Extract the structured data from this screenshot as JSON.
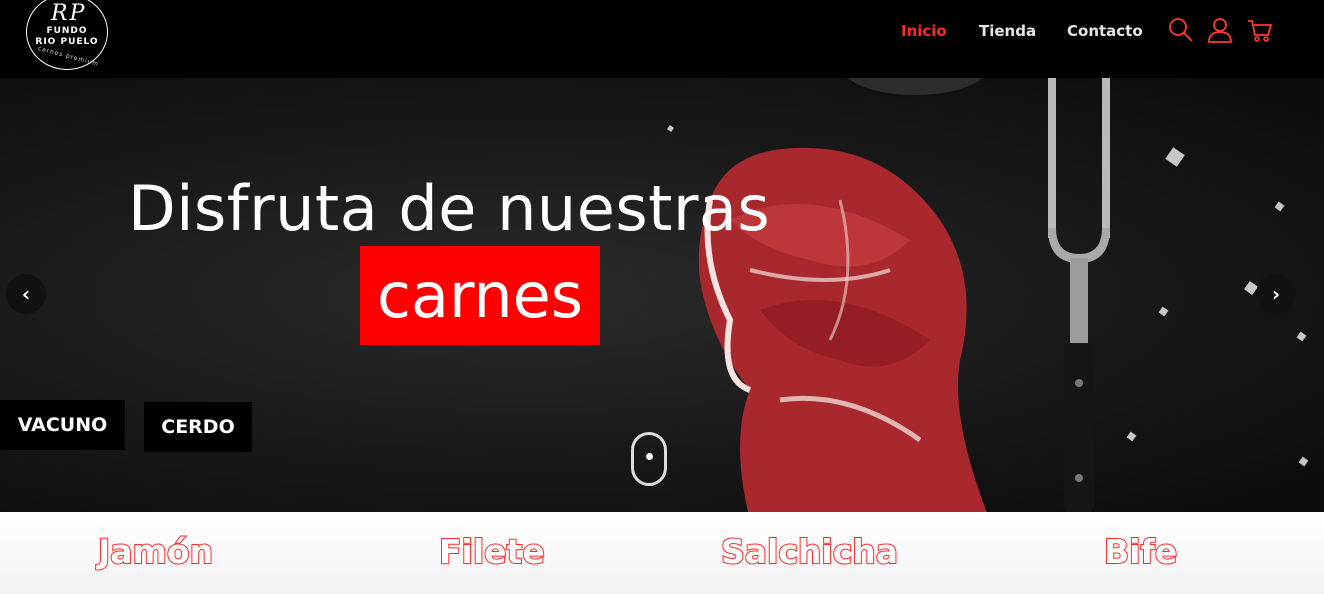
{
  "brand": {
    "logo_mono": "RP",
    "logo_line1": "FUNDO",
    "logo_line2": "RIO PUELO",
    "logo_tagline": "carnes premium"
  },
  "nav": {
    "items": [
      {
        "label": "Inicio",
        "active": true
      },
      {
        "label": "Tienda",
        "active": false
      },
      {
        "label": "Contacto",
        "active": false
      }
    ]
  },
  "header_icons": [
    "search-icon",
    "user-icon",
    "cart-icon"
  ],
  "hero": {
    "headline": "Disfruta de nuestras",
    "highlight": "carnes",
    "prev_arrow": "‹",
    "next_arrow": "›"
  },
  "categories": [
    {
      "label": "VACUNO"
    },
    {
      "label": "CERDO"
    }
  ],
  "products": [
    {
      "label": "Jamón"
    },
    {
      "label": "Filete"
    },
    {
      "label": "Salchicha"
    },
    {
      "label": "Bife"
    }
  ],
  "colors": {
    "accent": "#ff2a1e",
    "highlight_bg": "#ff0000",
    "header_bg": "#000000",
    "icon": "#ff3b30"
  }
}
